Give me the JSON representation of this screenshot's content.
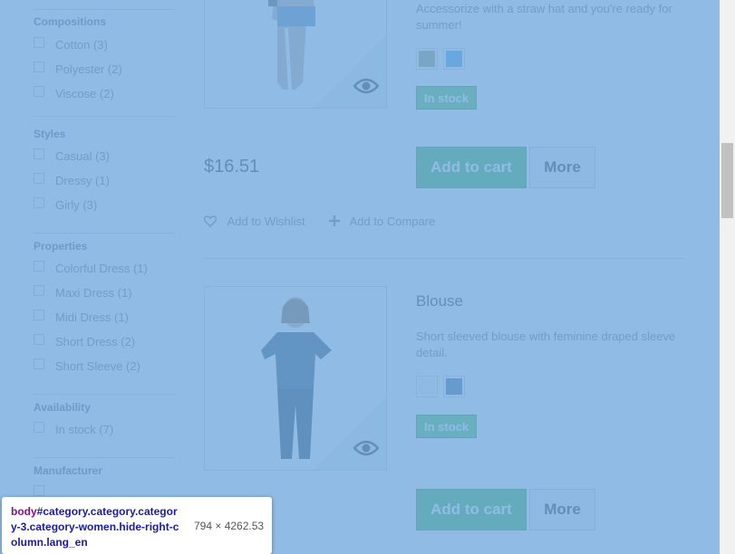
{
  "filters": {
    "compositions": {
      "title": "Compositions",
      "items": [
        {
          "label": "Cotton (3)"
        },
        {
          "label": "Polyester (2)"
        },
        {
          "label": "Viscose (2)"
        }
      ]
    },
    "styles": {
      "title": "Styles",
      "items": [
        {
          "label": "Casual (3)"
        },
        {
          "label": "Dressy (1)"
        },
        {
          "label": "Girly (3)"
        }
      ]
    },
    "properties": {
      "title": "Properties",
      "items": [
        {
          "label": "Colorful Dress (1)"
        },
        {
          "label": "Maxi Dress (1)"
        },
        {
          "label": "Midi Dress (1)"
        },
        {
          "label": "Short Dress (2)"
        },
        {
          "label": "Short Sleeve (2)"
        }
      ]
    },
    "availability": {
      "title": "Availability",
      "items": [
        {
          "label": "In stock (7)"
        }
      ]
    },
    "manufacturer": {
      "title": "Manufacturer"
    }
  },
  "products": [
    {
      "description": "Accessorize with a straw hat and you're ready for summer!",
      "swatches": [
        "#9f9a6d",
        "#4aa8e6"
      ],
      "stock": "In stock",
      "price": "$16.51",
      "add_to_cart": "Add to cart",
      "more": "More",
      "wishlist": "Add to Wishlist",
      "compare": "Add to Compare"
    },
    {
      "name": "Blouse",
      "description": "Short sleeved blouse with feminine draped sleeve detail.",
      "swatches": [
        "#f4f4f4",
        "#3f6f9a"
      ],
      "stock": "In stock",
      "add_to_cart": "Add to cart",
      "more": "More"
    }
  ],
  "inspector": {
    "tag": "body",
    "selector": "#category.category.category-3.category-women.hide-right-column.lang_en",
    "dimensions": "794 × 4262.53"
  },
  "colors": {
    "overlay": "#6fa8dc",
    "in_stock": "#55c65e",
    "add_to_cart": "#43b754"
  }
}
